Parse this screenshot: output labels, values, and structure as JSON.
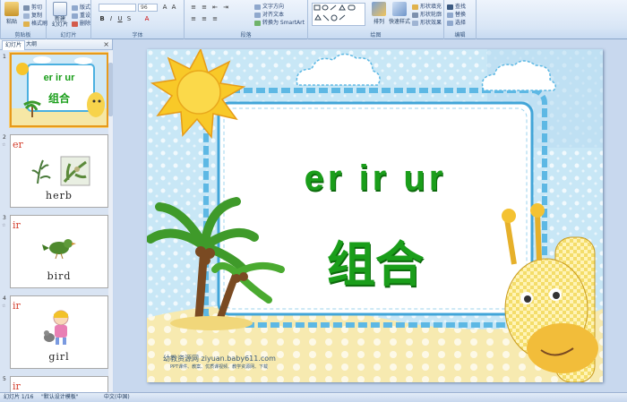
{
  "ribbon": {
    "clipboard": {
      "paste": "粘贴",
      "cut": "剪切",
      "copy": "复制",
      "format_painter": "格式刷",
      "label": "剪贴板"
    },
    "slides": {
      "new_slide": "新建\n幻灯片",
      "layout": "版式",
      "reset": "重设",
      "delete": "删除",
      "label": "幻灯片"
    },
    "font": {
      "font_name": "",
      "font_size": "96",
      "label": "字体"
    },
    "paragraph": {
      "text_direction": "文字方向",
      "align_text": "对齐文本",
      "smartart": "转换为 SmartArt",
      "label": "段落"
    },
    "drawing": {
      "arrange": "排列",
      "quick_styles": "快速样式",
      "shape_fill": "形状填充",
      "shape_outline": "形状轮廓",
      "shape_effects": "形状效果",
      "label": "绘图"
    },
    "editing": {
      "find": "查找",
      "replace": "替换",
      "select": "选择",
      "label": "编辑"
    }
  },
  "panel": {
    "tab_slides": "幻灯片",
    "tab_outline": "大纲",
    "close": "×",
    "thumbnails": [
      {
        "num": "1",
        "title": "er ir ur",
        "subtitle": "组合"
      },
      {
        "num": "2",
        "head": "er",
        "word": "herb"
      },
      {
        "num": "3",
        "head": "ir",
        "word": "bird"
      },
      {
        "num": "4",
        "head": "ir",
        "word": "girl"
      },
      {
        "num": "5",
        "head": "ir"
      }
    ]
  },
  "slide": {
    "title": "er ir ur",
    "subtitle": "组合",
    "watermark": "幼教资源网 ziyuan.baby611.com",
    "watermark_small": "PPT课件、教案、优质课视频、教学资源网、下载"
  },
  "statusbar": {
    "slide_index": "幻灯片 1/16",
    "theme": "\"默认设计模板\"",
    "language": "中文(中国)"
  },
  "colors": {
    "title_green": "#1a9e1a",
    "selection_orange": "#e79a1b",
    "ribbon_bg": "#d9e6f6"
  }
}
